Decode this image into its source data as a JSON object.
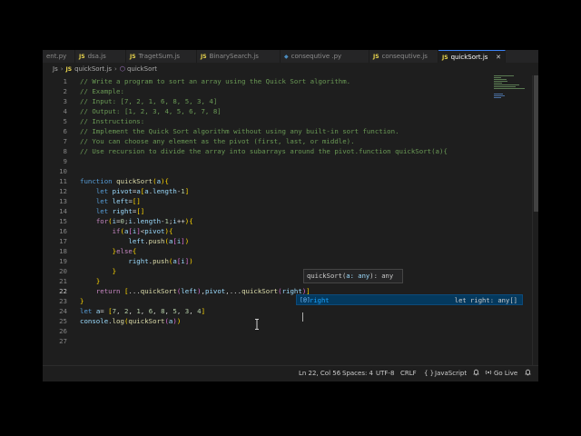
{
  "tabs": [
    {
      "label": "ent.py",
      "active": false
    },
    {
      "label": "dsa.js",
      "active": false
    },
    {
      "label": "TragetSum.js",
      "active": false
    },
    {
      "label": "BinarySearch.js",
      "active": false
    },
    {
      "label": "consequtive .py",
      "active": false
    },
    {
      "label": "consequtive.js",
      "active": false
    },
    {
      "label": "quickSort.js",
      "active": true
    }
  ],
  "breadcrumb": {
    "folder": "Js",
    "file": "quickSort.js",
    "symbol": "quickSort"
  },
  "editor": {
    "current_line": 22,
    "line_numbers": [
      "1",
      "2",
      "3",
      "4",
      "5",
      "6",
      "7",
      "8",
      "9",
      "10",
      "11",
      "12",
      "13",
      "14",
      "15",
      "16",
      "17",
      "18",
      "19",
      "20",
      "21",
      "22",
      "23",
      "24",
      "25",
      "26",
      "27"
    ],
    "lines": [
      "// Write a program to sort an array using the Quick Sort algorithm.",
      "// Example:",
      "// Input: [7, 2, 1, 6, 8, 5, 3, 4]",
      "// Output: [1, 2, 3, 4, 5, 6, 7, 8]",
      "// Instructions:",
      "// Implement the Quick Sort algorithm without using any built-in sort function.",
      "// You can choose any element as the pivot (first, last, or middle).",
      "// Use recursion to divide the array into subarrays around the pivot.function quickSort(a){",
      "",
      "",
      "function quickSort(a){",
      "    let pivot=a[a.length-1]",
      "    let left=[]",
      "    let right=[]",
      "    for(i=0;i.length-1;i++){",
      "        if(a[i]<pivot){",
      "            left.push(a[i])",
      "        }else{",
      "            right.push(a[i])",
      "        }",
      "    }",
      "    return [...quickSort(left),pivot,...quickSort(right)]",
      "}",
      "let a= [7, 2, 1, 6, 8, 5, 3, 4]",
      "console.log(quickSort(a))",
      "",
      ""
    ]
  },
  "parameter_hint": {
    "prefix": "quickSort(",
    "param": "a: any",
    "suffix": "): any"
  },
  "suggestion": {
    "icon": "[@]",
    "label": "right",
    "detail": "let right: any[]"
  },
  "statusbar": {
    "position": "Ln 22, Col 56",
    "spaces": "Spaces: 4",
    "encoding": "UTF-8",
    "eol": "CRLF",
    "language_icon": "{ }",
    "language": "JavaScript",
    "go_live": "Go Live"
  },
  "colors": {
    "editor_bg": "#1e1e1e",
    "comment": "#6a9955",
    "keyword": "#569cd6",
    "function": "#dcdcaa",
    "variable": "#9cdcfe",
    "number": "#b5cea8",
    "accent": "#3b82f6"
  }
}
